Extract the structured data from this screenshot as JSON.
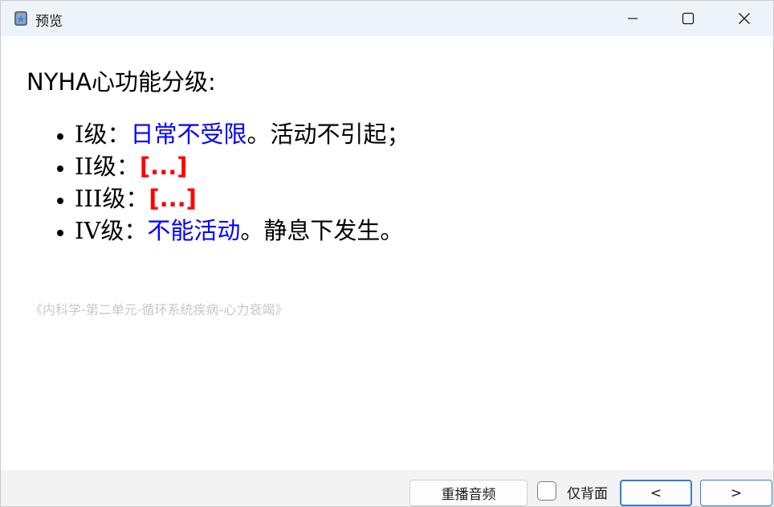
{
  "window": {
    "title": "预览"
  },
  "card": {
    "heading": "NYHA心功能分级:",
    "grades": [
      {
        "grade": "I级：",
        "answer": "日常不受限",
        "rest": "。活动不引起；",
        "cloze": ""
      },
      {
        "grade": "II级：",
        "answer": "",
        "rest": "",
        "cloze": "[...]"
      },
      {
        "grade": "III级：",
        "answer": "",
        "rest": "",
        "cloze": "[...]"
      },
      {
        "grade": "IV级：",
        "answer": "不能活动",
        "rest": "。静息下发生。",
        "cloze": ""
      }
    ],
    "source": "《内科学-第二单元-循环系统疾病-心力衰竭》"
  },
  "bottombar": {
    "replay_label": "重播音频",
    "back_only_label": "仅背面",
    "back_only_checked": false,
    "prev_label": "<",
    "next_label": ">"
  },
  "colors": {
    "answer": "#0000ff",
    "cloze": "#ff0000",
    "source": "#c8c8c8",
    "focus_border": "#3a7bd5"
  },
  "icons": {
    "app": "anki-app-icon",
    "minimize": "minimize-icon",
    "maximize": "maximize-icon",
    "close": "close-icon"
  }
}
